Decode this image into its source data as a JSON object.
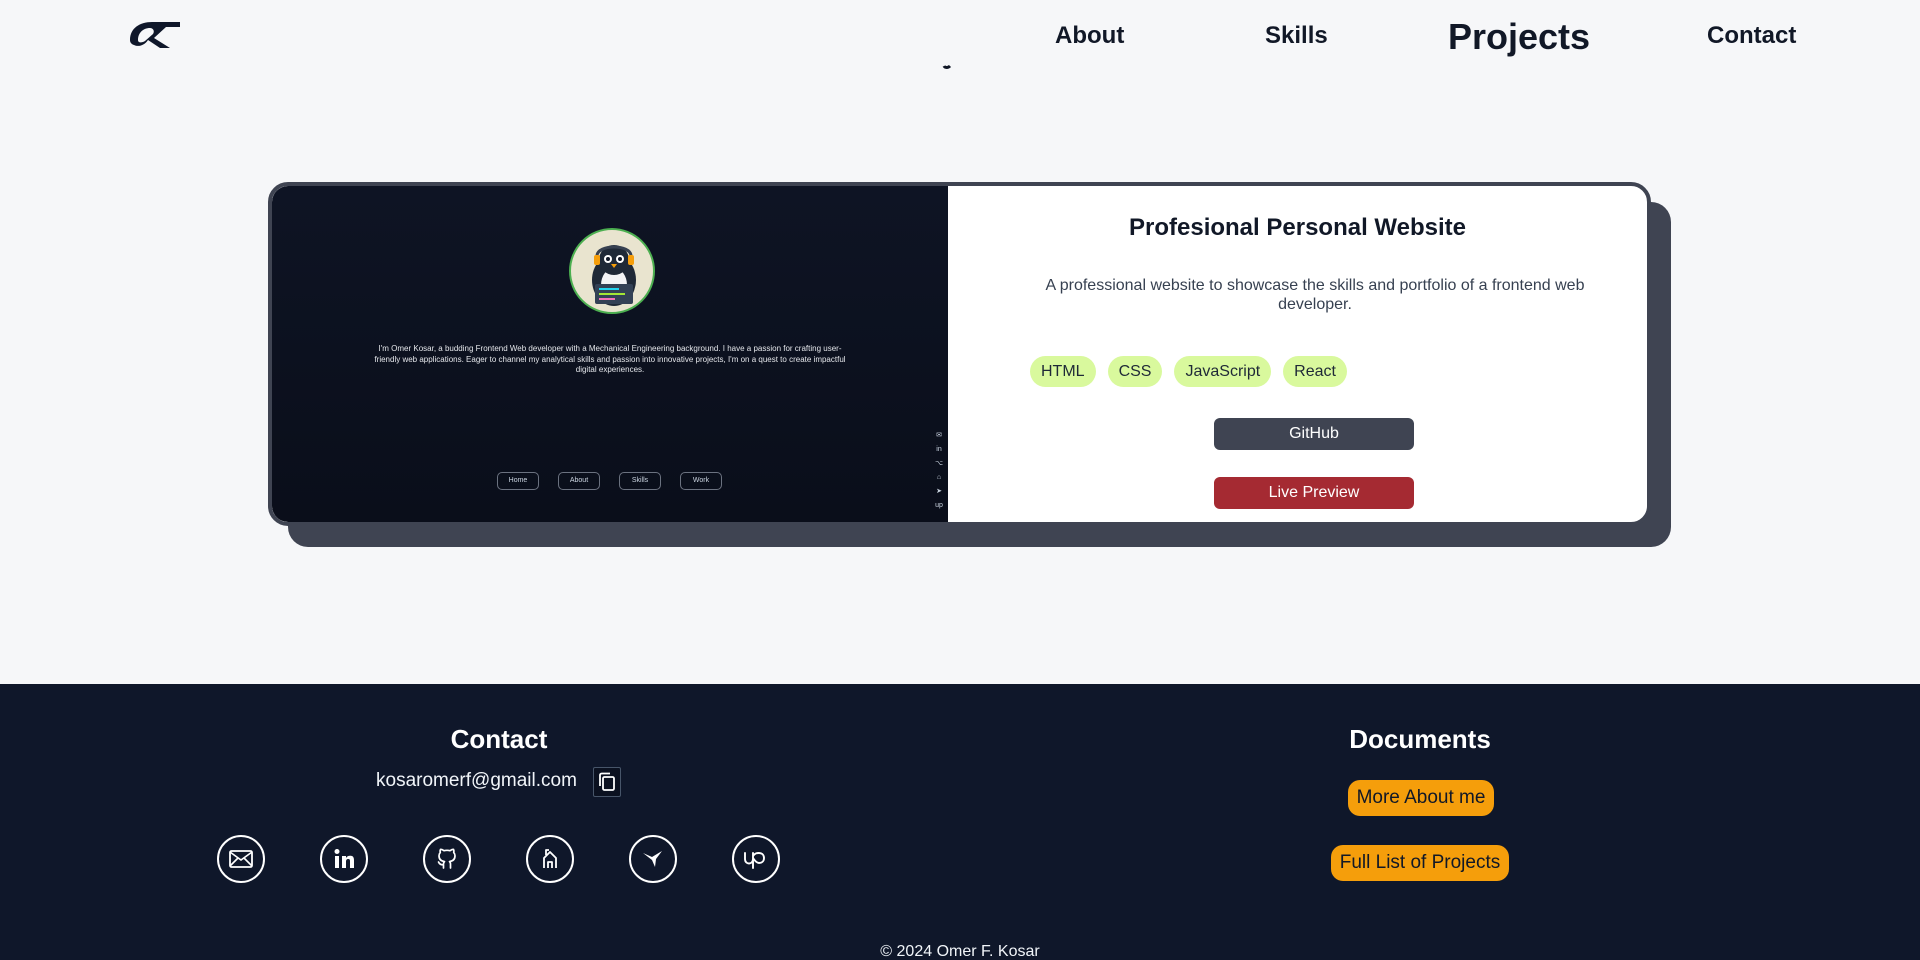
{
  "nav": {
    "logo_alt": "OK",
    "links": [
      "About",
      "Skills",
      "Projects",
      "Contact"
    ]
  },
  "project": {
    "title": "Profesional Personal Website",
    "description": "A professional website to showcase the skills and portfolio of a frontend web developer.",
    "tags": [
      "HTML",
      "CSS",
      "JavaScript",
      "React"
    ],
    "github_label": "GitHub",
    "live_label": "Live Preview",
    "preview": {
      "text": "I'm Omer Kosar, a budding Frontend Web developer with a Mechanical Engineering background. I have a passion for crafting user-friendly web applications. Eager to channel my analytical skills and passion into innovative projects, I'm on a quest to create impactful digital experiences.",
      "buttons": [
        "Home",
        "About",
        "Skills",
        "Work"
      ],
      "side_icons": [
        "✉",
        "in",
        "⌥",
        "⌂",
        "➤",
        "up"
      ]
    }
  },
  "footer": {
    "contact_title": "Contact",
    "email": "kosaromerf@gmail.com",
    "socials": [
      "mail-icon",
      "linkedin-icon",
      "github-icon",
      "freecodecamp-icon",
      "hummingbird-icon",
      "upwork-icon"
    ],
    "documents_title": "Documents",
    "more_about": "More About me",
    "full_projects": "Full List of Projects",
    "copyright": "© 2024 Omer F. Kosar"
  },
  "colors": {
    "page_bg": "#f6f7f9",
    "card_border": "#3f4452",
    "tag_bg": "#d9f99d",
    "live_btn": "#a52a32",
    "footer_bg": "#0f172a",
    "doc_btn": "#f59e0b"
  }
}
